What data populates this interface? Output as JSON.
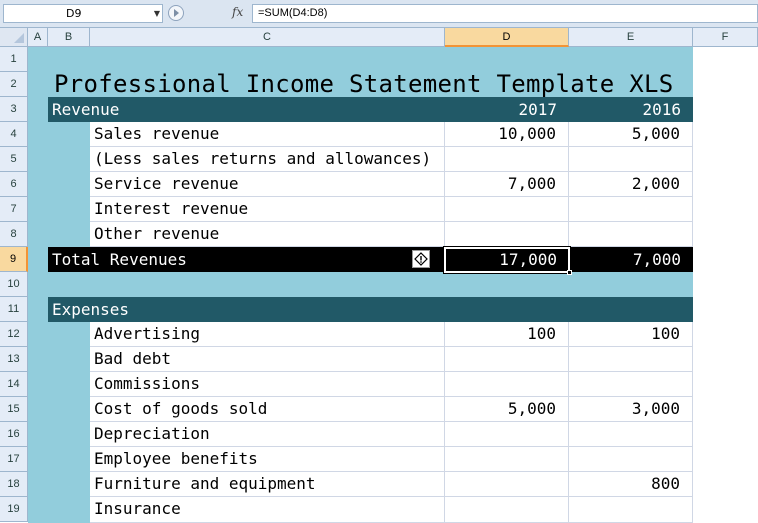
{
  "formula_bar": {
    "name_box": "D9",
    "fx_label": "fx",
    "formula": "=SUM(D4:D8)"
  },
  "columns": [
    "A",
    "B",
    "C",
    "D",
    "E",
    "F"
  ],
  "selected_column": "D",
  "rows": [
    "1",
    "2",
    "3",
    "4",
    "5",
    "6",
    "7",
    "8",
    "9",
    "10",
    "11",
    "12",
    "13",
    "14",
    "15",
    "16",
    "17",
    "18",
    "19"
  ],
  "selected_row": "9",
  "sheet": {
    "title": "Professional Income Statement Template XLS",
    "revenue_header": {
      "label": "Revenue",
      "year1": "2017",
      "year2": "2016"
    },
    "revenue_items": [
      {
        "label": "Sales revenue",
        "v2017": "10,000",
        "v2016": "5,000"
      },
      {
        "label": "(Less sales returns and allowances)",
        "v2017": "",
        "v2016": ""
      },
      {
        "label": "Service revenue",
        "v2017": "7,000",
        "v2016": "2,000"
      },
      {
        "label": "Interest revenue",
        "v2017": "",
        "v2016": ""
      },
      {
        "label": "Other revenue",
        "v2017": "",
        "v2016": ""
      }
    ],
    "total_revenues": {
      "label": "Total Revenues",
      "v2017": "17,000",
      "v2016": "7,000"
    },
    "expenses_header": {
      "label": "Expenses"
    },
    "expense_items": [
      {
        "label": "Advertising",
        "v2017": "100",
        "v2016": "100"
      },
      {
        "label": "Bad debt",
        "v2017": "",
        "v2016": ""
      },
      {
        "label": "Commissions",
        "v2017": "",
        "v2016": ""
      },
      {
        "label": "Cost of goods sold",
        "v2017": "5,000",
        "v2016": "3,000"
      },
      {
        "label": "Depreciation",
        "v2017": "",
        "v2016": ""
      },
      {
        "label": "Employee benefits",
        "v2017": "",
        "v2016": ""
      },
      {
        "label": "Furniture and equipment",
        "v2017": "",
        "v2016": "800"
      },
      {
        "label": "Insurance",
        "v2017": "",
        "v2016": ""
      }
    ]
  },
  "colors": {
    "sheet_bg": "#92cddc",
    "band": "#215967",
    "total_band": "#000000",
    "selection_header": "#f9d99f"
  },
  "icons": {
    "error_indicator": "diamond-exclamation-icon",
    "dropdown": "chevron-down-icon"
  }
}
